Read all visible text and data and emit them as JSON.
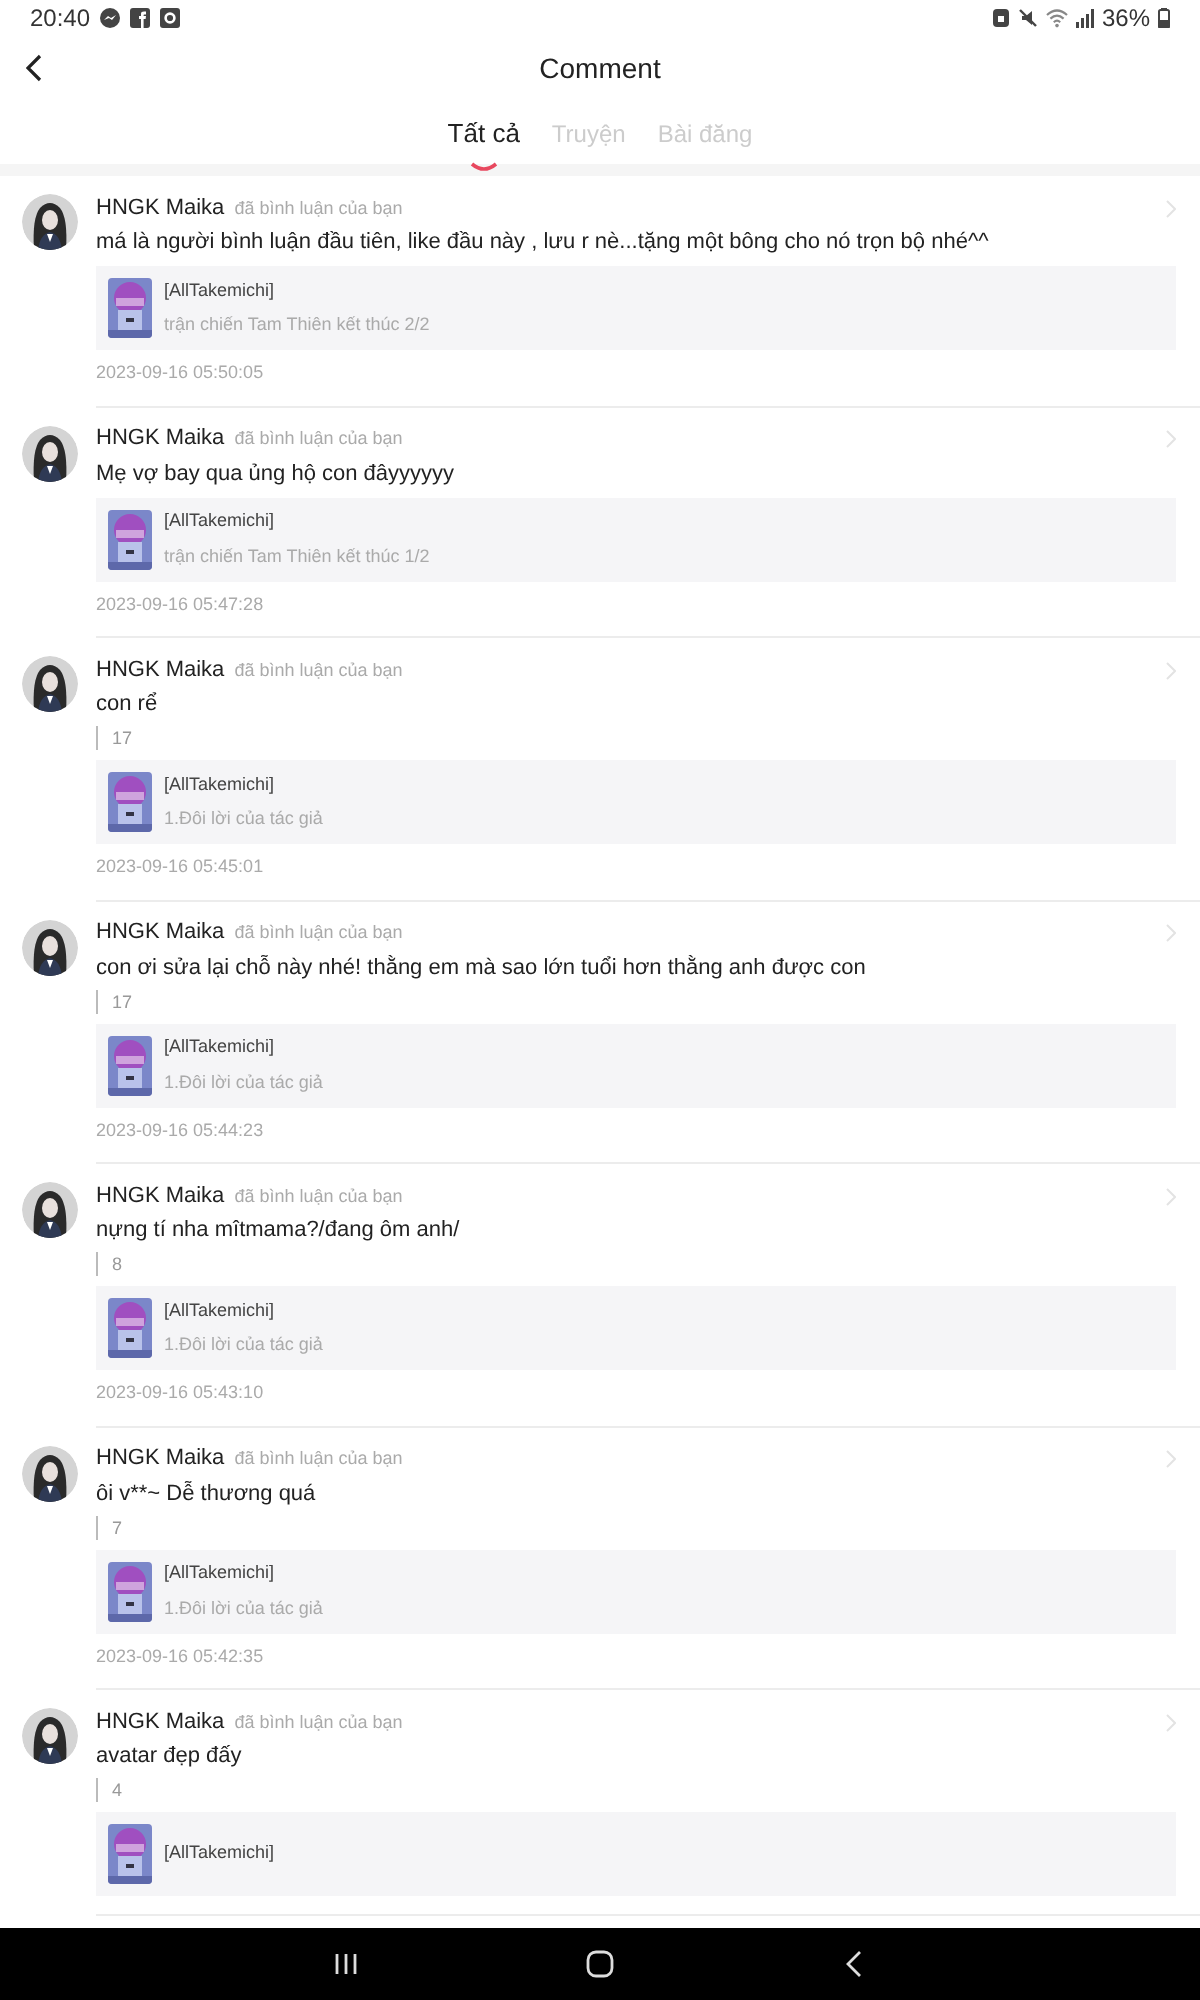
{
  "status_bar": {
    "time": "20:40",
    "battery": "36%"
  },
  "header": {
    "title": "Comment"
  },
  "tabs": [
    {
      "label": "Tất cả",
      "selected": true
    },
    {
      "label": "Truyện",
      "selected": false
    },
    {
      "label": "Bài đăng",
      "selected": false
    }
  ],
  "comments": [
    {
      "user": "HNGK Maika",
      "action": "đã bình luận của bạn",
      "text": "má là người bình luận đầu tiên, like đầu này , lưu r nè...tặng một bông cho nó trọn bộ nhé^^",
      "book": {
        "title": "[AllTakemichi]",
        "chapter": "trận chiến Tam Thiên kết thúc 2/2"
      },
      "time": "2023-09-16 05:50:05"
    },
    {
      "user": "HNGK Maika",
      "action": "đã bình luận của bạn",
      "text": "Mẹ vợ bay qua ủng hộ con đâyyyyyy",
      "book": {
        "title": "[AllTakemichi]",
        "chapter": "trận chiến Tam Thiên kết thúc 1/2"
      },
      "time": "2023-09-16 05:47:28"
    },
    {
      "user": "HNGK Maika",
      "action": "đã bình luận của bạn",
      "text": "con rể",
      "quote": "17",
      "book": {
        "title": "[AllTakemichi]",
        "chapter": "1.Đôi lời của tác giả"
      },
      "time": "2023-09-16 05:45:01"
    },
    {
      "user": "HNGK Maika",
      "action": "đã bình luận của bạn",
      "text": "con ơi sửa lại chỗ này nhé! thằng em mà sao lớn tuổi hơn thằng anh được con",
      "quote": "17",
      "book": {
        "title": "[AllTakemichi]",
        "chapter": "1.Đôi lời của tác giả"
      },
      "time": "2023-09-16 05:44:23"
    },
    {
      "user": "HNGK Maika",
      "action": "đã bình luận của bạn",
      "text": "nựng tí nha mîtmama?/đang ôm anh/",
      "quote": "8",
      "book": {
        "title": "[AllTakemichi]",
        "chapter": "1.Đôi lời của tác giả"
      },
      "time": "2023-09-16 05:43:10"
    },
    {
      "user": "HNGK Maika",
      "action": "đã bình luận của bạn",
      "text": "ôi v**~ Dễ thương quá",
      "quote": "7",
      "book": {
        "title": "[AllTakemichi]",
        "chapter": "1.Đôi lời của tác giả"
      },
      "time": "2023-09-16 05:42:35"
    },
    {
      "user": "HNGK Maika",
      "action": "đã bình luận của bạn",
      "text": "avatar đẹp đấy",
      "quote": "4",
      "book": {
        "title": "[AllTakemichi]"
      }
    }
  ]
}
